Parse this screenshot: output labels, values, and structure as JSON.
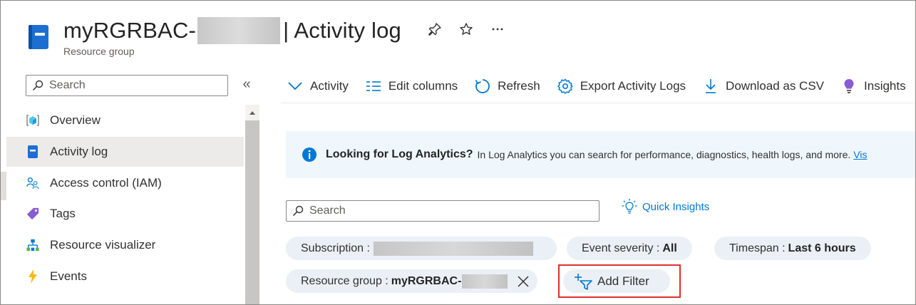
{
  "header": {
    "title_prefix": "myRGRBAC-",
    "title_suffix": "| Activity log",
    "subtitle": "Resource group",
    "pin_icon": "pin-icon",
    "favorite_icon": "star-icon",
    "more_icon": "more-icon"
  },
  "sidebar": {
    "search": {
      "placeholder": "Search",
      "value": ""
    },
    "collapse_label": "«",
    "items": [
      {
        "label": "Overview",
        "icon": "overview-icon",
        "active": false
      },
      {
        "label": "Activity log",
        "icon": "activity-log-icon",
        "active": true
      },
      {
        "label": "Access control (IAM)",
        "icon": "people-icon",
        "active": false
      },
      {
        "label": "Tags",
        "icon": "tag-icon",
        "active": false
      },
      {
        "label": "Resource visualizer",
        "icon": "visualizer-icon",
        "active": false
      },
      {
        "label": "Events",
        "icon": "lightning-icon",
        "active": false
      }
    ]
  },
  "toolbar": {
    "activity": "Activity",
    "edit_columns": "Edit columns",
    "refresh": "Refresh",
    "export": "Export Activity Logs",
    "download": "Download as CSV",
    "insights": "Insights"
  },
  "banner": {
    "bold": "Looking for Log Analytics?",
    "message": "In Log Analytics you can search for performance, diagnostics, health logs, and more.",
    "link": "Vis"
  },
  "filters": {
    "search_placeholder": "Search",
    "quick_insights": "Quick Insights",
    "subscription_label": "Subscription :",
    "severity_label": "Event severity :",
    "severity_value": "All",
    "timespan_label": "Timespan :",
    "timespan_value": "Last 6 hours",
    "resource_group_label": "Resource group :",
    "resource_group_value": "myRGRBAC-",
    "add_filter": "Add Filter"
  },
  "colors": {
    "accent": "#0078d4",
    "highlight": "#e02f2f",
    "pill_bg": "#eaf0f6",
    "banner_bg": "#eff6fc"
  }
}
